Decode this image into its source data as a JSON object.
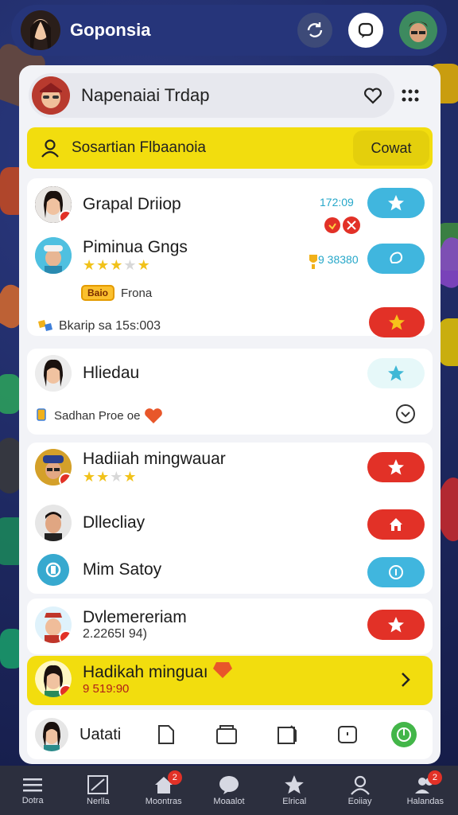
{
  "app": {
    "title": "Goponsia"
  },
  "search": {
    "text": "Napenaiai Trdap"
  },
  "banner": {
    "label": "Sosartian Flbaanoia",
    "button": "Cowat"
  },
  "group1": {
    "row1": {
      "name": "Grapal Driiop",
      "meta": "172:09"
    },
    "row2": {
      "name": "Piminua Gngs",
      "stars": 3,
      "tag": "Baio",
      "tag_text": "Frona",
      "meta": "9 38380"
    },
    "footer": "Bkarip sa 15s:003"
  },
  "group2": {
    "row1": {
      "name": "Hliedau"
    },
    "footer": "Sadhan Proe oe"
  },
  "group3": {
    "row1": {
      "name": "Hadiiah mingwauar",
      "stars": 3
    },
    "row2": {
      "name": "Dllecliay"
    },
    "row3": {
      "name": "Mim Satoy"
    }
  },
  "group4": {
    "row1": {
      "name": "Dvlemereriam",
      "sub": "2.2265I 94)"
    }
  },
  "promo": {
    "name": "Hadikah minguaı",
    "sub": "9 519:90"
  },
  "bottom": {
    "label": "Uatati"
  },
  "nav": [
    {
      "label": "Dotra",
      "icon": "menu-icon"
    },
    {
      "label": "Nerlla",
      "icon": "edit-icon"
    },
    {
      "label": "Moontras",
      "icon": "home-icon",
      "badge": "2"
    },
    {
      "label": "Moaalot",
      "icon": "chat-icon"
    },
    {
      "label": "Elrical",
      "icon": "star-icon"
    },
    {
      "label": "Eoiiay",
      "icon": "person-icon"
    },
    {
      "label": "Halandas",
      "icon": "group-icon",
      "badge": "2"
    }
  ],
  "colors": {
    "yellow": "#f2dd0e",
    "red": "#e23127",
    "blue": "#40b6de",
    "navy": "#26357a"
  }
}
